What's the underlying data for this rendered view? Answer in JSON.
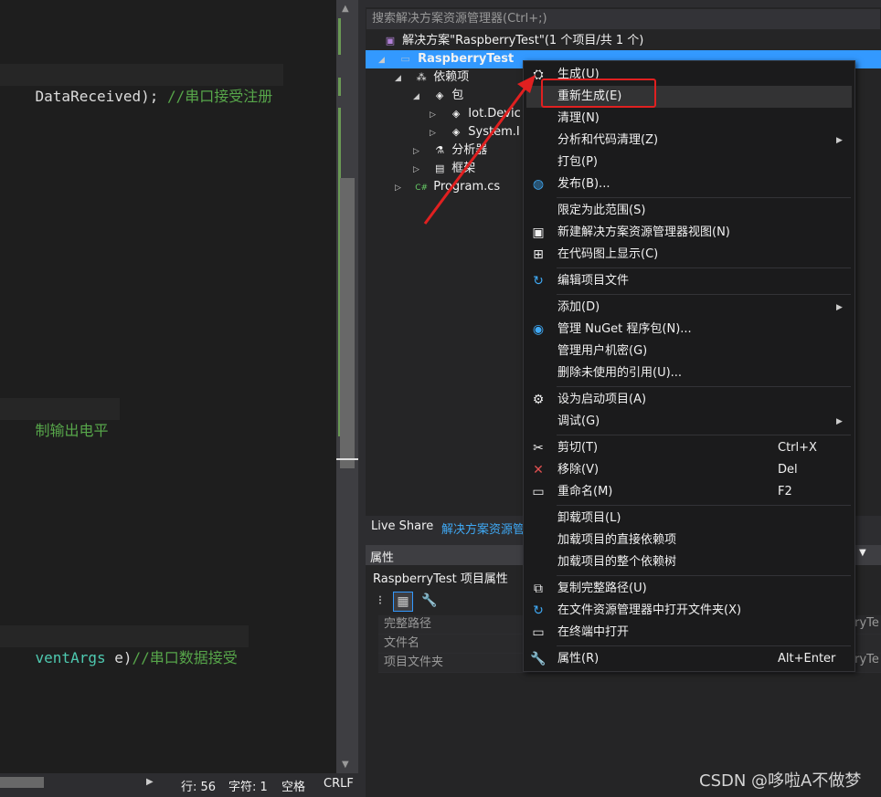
{
  "editor": {
    "lines": [
      {
        "parts": [
          {
            "cls": "p",
            "text": "DataReceived); "
          },
          {
            "cls": "c",
            "text": "//串口接受注册"
          }
        ]
      },
      {
        "parts": [
          {
            "cls": "c",
            "text": "制输出电平"
          }
        ]
      },
      {
        "parts": [
          {
            "cls": "t",
            "text": "ventArgs"
          },
          {
            "cls": "p",
            "text": " e)"
          },
          {
            "cls": "c",
            "text": "//串口数据接受"
          }
        ]
      }
    ]
  },
  "statusbar": {
    "line": "行: 56",
    "char": "字符: 1",
    "spaces": "空格",
    "eol": "CRLF"
  },
  "solution_explorer": {
    "search_placeholder": "搜索解决方案资源管理器(Ctrl+;)",
    "solution": "解决方案\"RaspberryTest\"(1 个项目/共 1 个)",
    "project": "RaspberryTest",
    "dependencies": "依赖项",
    "packages": "包",
    "pkg1": "Iot.Devic",
    "pkg2": "System.I",
    "analyzers": "分析器",
    "frameworks": "框架",
    "program": "Program.cs"
  },
  "tabs": {
    "live_share": "Live Share",
    "solution_explorer": "解决方案资源管"
  },
  "properties": {
    "header": "属性",
    "title": "RaspberryTest 项目属性",
    "rows": [
      "完整路径",
      "文件名",
      "项目文件夹"
    ],
    "right_value1": "rryTe",
    "right_value2": "rryTe"
  },
  "context_menu": {
    "build": "生成(U)",
    "rebuild": "重新生成(E)",
    "clean": "清理(N)",
    "analyze": "分析和代码清理(Z)",
    "pack": "打包(P)",
    "publish": "发布(B)...",
    "scope": "限定为此范围(S)",
    "new_view": "新建解决方案资源管理器视图(N)",
    "code_map": "在代码图上显示(C)",
    "edit_project": "编辑项目文件",
    "add": "添加(D)",
    "nuget": "管理 NuGet 程序包(N)...",
    "user_secrets": "管理用户机密(G)",
    "remove_unused": "删除未使用的引用(U)...",
    "startup": "设为启动项目(A)",
    "debug": "调试(G)",
    "cut": "剪切(T)",
    "cut_key": "Ctrl+X",
    "remove": "移除(V)",
    "remove_key": "Del",
    "rename": "重命名(M)",
    "rename_key": "F2",
    "unload": "卸载项目(L)",
    "load_direct": "加载项目的直接依赖项",
    "load_tree": "加载项目的整个依赖树",
    "copy_path": "复制完整路径(U)",
    "open_folder": "在文件资源管理器中打开文件夹(X)",
    "open_terminal": "在终端中打开",
    "props": "属性(R)",
    "props_key": "Alt+Enter"
  },
  "watermark": "CSDN @哆啦A不做梦",
  "colors": {
    "selection": "#3399ff",
    "highlight_box": "#e02020",
    "arrow": "#e02020"
  }
}
